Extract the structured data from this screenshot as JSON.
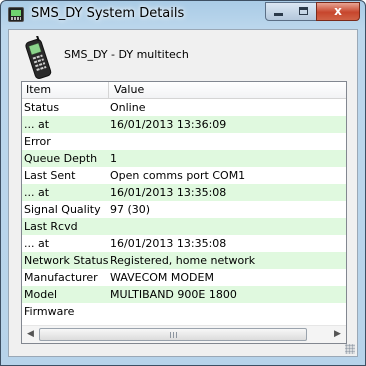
{
  "window": {
    "title": "SMS_DY System Details"
  },
  "titlebar_buttons": {
    "close_glyph": "x"
  },
  "device": {
    "name": "SMS_DY - DY multitech",
    "icon": "mobile-phone-icon"
  },
  "listview": {
    "columns": [
      "Item",
      "Value"
    ],
    "rows": [
      {
        "item": "Status",
        "value": "Online"
      },
      {
        "item": "... at",
        "value": "16/01/2013 13:36:09"
      },
      {
        "item": "Error",
        "value": ""
      },
      {
        "item": "Queue Depth",
        "value": "1"
      },
      {
        "item": "Last Sent",
        "value": "Open comms port COM1"
      },
      {
        "item": "... at",
        "value": "16/01/2013 13:35:08"
      },
      {
        "item": "Signal Quality",
        "value": "97 (30)"
      },
      {
        "item": "Last Rcvd",
        "value": ""
      },
      {
        "item": "... at",
        "value": "16/01/2013 13:35:08"
      },
      {
        "item": "Network Status",
        "value": "Registered, home network"
      },
      {
        "item": "Manufacturer",
        "value": " WAVECOM MODEM"
      },
      {
        "item": "Model",
        "value": " MULTIBAND  900E  1800"
      },
      {
        "item": "Firmware",
        "value": ""
      }
    ],
    "row_alt_color": "#e0f9df"
  },
  "scrollbar": {
    "left_arrow": "◀",
    "right_arrow": "▶"
  },
  "colors": {
    "titlebar": "#b7d3ea",
    "close_button": "#c7462d"
  }
}
